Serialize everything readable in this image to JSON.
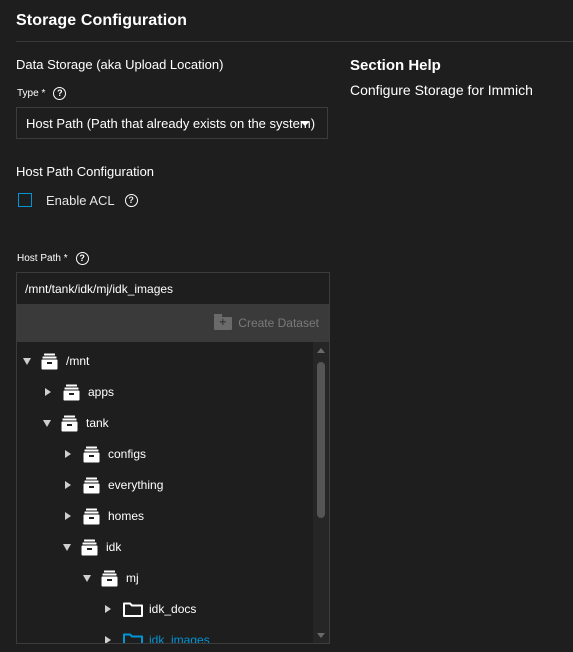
{
  "page": {
    "title": "Storage Configuration"
  },
  "data_storage": {
    "section_label": "Data Storage (aka Upload Location)",
    "type_label": "Type *",
    "type_value": "Host Path (Path that already exists on the system)"
  },
  "host_path_config": {
    "section_label": "Host Path Configuration",
    "enable_acl_label": "Enable ACL",
    "enable_acl_checked": false
  },
  "host_path": {
    "label": "Host Path *",
    "value": "/mnt/tank/idk/mj/idk_images",
    "create_dataset_label": "Create Dataset"
  },
  "help": {
    "title": "Section Help",
    "text": "Configure Storage for Immich"
  },
  "tree": [
    {
      "name": "/mnt",
      "icon": "dataset-icon",
      "expanded": true,
      "depth": 0
    },
    {
      "name": "apps",
      "icon": "dataset-icon",
      "expanded": false,
      "depth": 1
    },
    {
      "name": "tank",
      "icon": "dataset-icon",
      "expanded": true,
      "depth": 1
    },
    {
      "name": "configs",
      "icon": "dataset-icon",
      "expanded": false,
      "depth": 2
    },
    {
      "name": "everything",
      "icon": "dataset-icon",
      "expanded": false,
      "depth": 2
    },
    {
      "name": "homes",
      "icon": "dataset-icon",
      "expanded": false,
      "depth": 2
    },
    {
      "name": "idk",
      "icon": "dataset-icon",
      "expanded": true,
      "depth": 2
    },
    {
      "name": "mj",
      "icon": "dataset-icon",
      "expanded": true,
      "depth": 3
    },
    {
      "name": "idk_docs",
      "icon": "folder-icon",
      "expanded": false,
      "depth": 4
    },
    {
      "name": "idk_images",
      "icon": "folder-icon",
      "expanded": false,
      "depth": 4,
      "selected": true
    }
  ],
  "colors": {
    "background": "#1e1e1e",
    "accent": "#0095d5",
    "toolbar": "#3a3a3a"
  }
}
